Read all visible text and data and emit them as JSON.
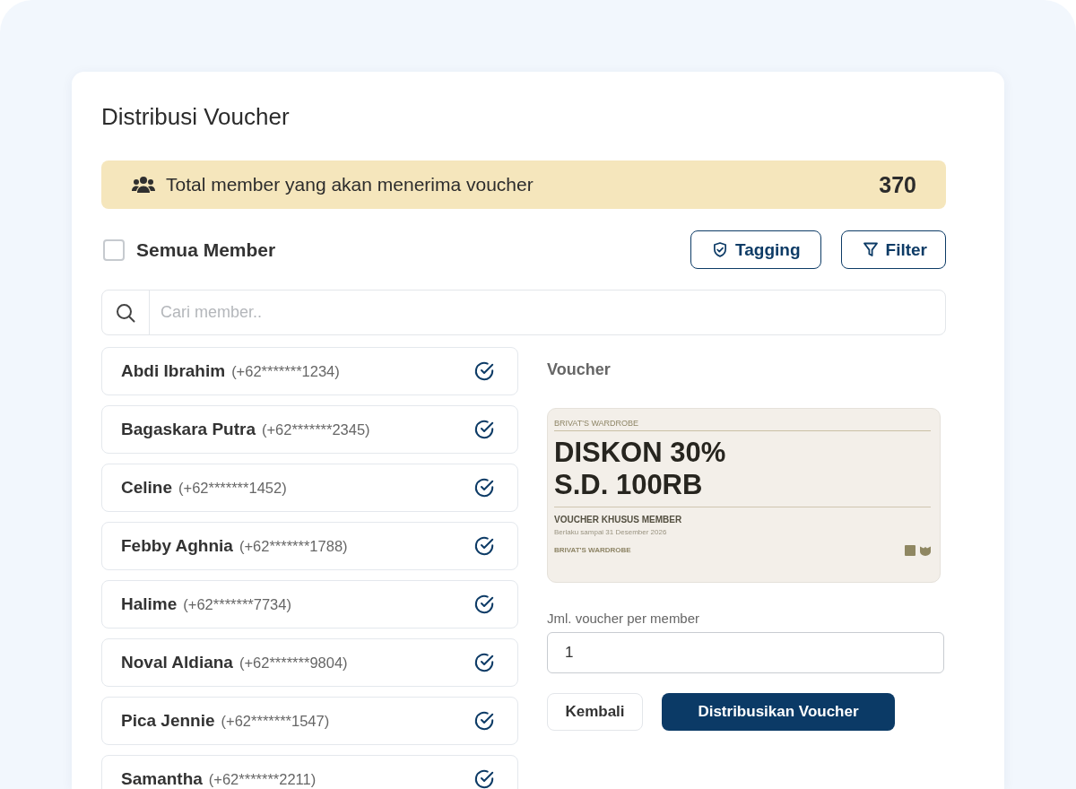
{
  "page": {
    "title": "Distribusi Voucher"
  },
  "summary_banner": {
    "label": "Total member yang akan menerima voucher",
    "count": "370"
  },
  "select_all": {
    "label": "Semua Member",
    "checked": false
  },
  "toolbar_buttons": [
    {
      "label": "Tagging",
      "kind": "tagging"
    },
    {
      "label": "Filter",
      "kind": "filter"
    }
  ],
  "search": {
    "placeholder": "Cari member.."
  },
  "members": [
    {
      "name": "Abdi Ibrahim",
      "phone": "(+62*******1234)",
      "checked": true
    },
    {
      "name": "Bagaskara Putra",
      "phone": "(+62*******2345)",
      "checked": true
    },
    {
      "name": "Celine",
      "phone": "(+62*******1452)",
      "checked": true
    },
    {
      "name": "Febby Aghnia",
      "phone": "(+62*******1788)",
      "checked": true
    },
    {
      "name": "Halime",
      "phone": "(+62*******7734)",
      "checked": true
    },
    {
      "name": "Noval Aldiana",
      "phone": "(+62*******9804)",
      "checked": true
    },
    {
      "name": "Pica Jennie",
      "phone": "(+62*******1547)",
      "checked": true
    },
    {
      "name": "Samantha",
      "phone": "(+62*******2211)",
      "checked": true
    }
  ],
  "voucher_panel": {
    "heading": "Voucher",
    "voucher_card": {
      "brand_top": "BRIVAT'S WARDROBE",
      "headline_lines": [
        "DISKON 30%",
        "S.D. 100RB"
      ],
      "subtitle": "VOUCHER KHUSUS MEMBER",
      "validity": "Berlaku sampai 31 Desember 2026",
      "brand_bottom": "BRIVAT'S WARDROBE"
    },
    "quantity_field": {
      "label": "Jml. voucher per member",
      "value": "1"
    }
  },
  "actions": [
    {
      "label": "Kembali",
      "kind": "secondary"
    },
    {
      "label": "Distribusikan Voucher",
      "kind": "primary"
    }
  ]
}
